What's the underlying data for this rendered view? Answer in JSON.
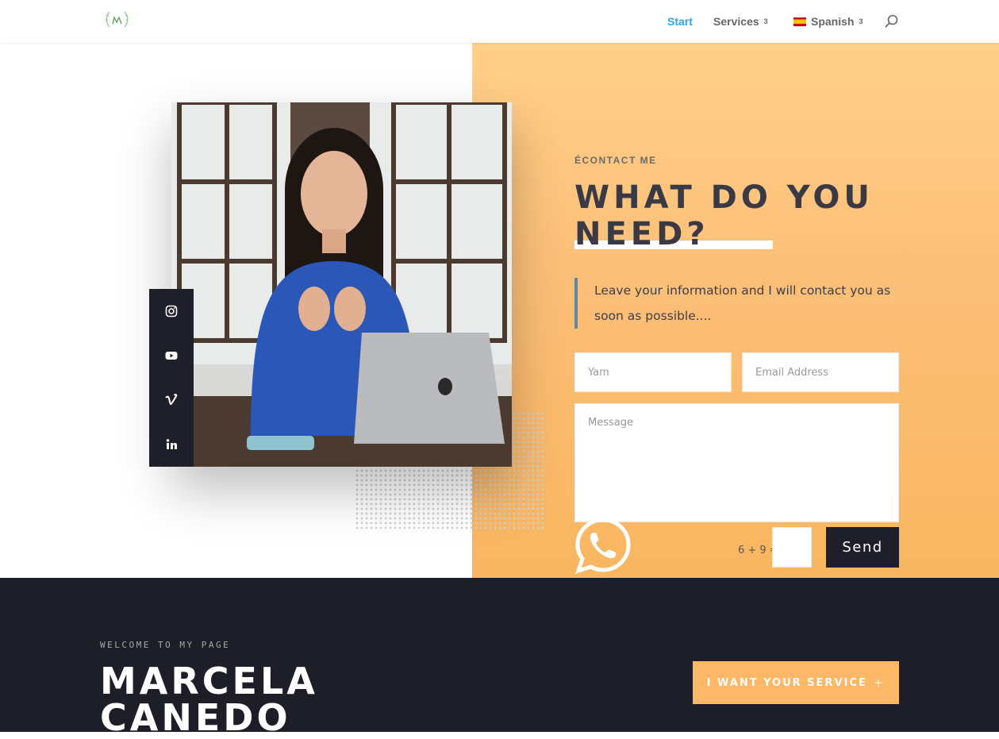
{
  "header": {
    "nav": [
      {
        "label": "Start",
        "active": true
      },
      {
        "label": "Services",
        "caret": "3"
      },
      {
        "label": "Spanish",
        "caret": "3",
        "flag": "es"
      }
    ],
    "search_icon": "search-icon",
    "colors": {
      "active": "#2ea3f2",
      "text": "#666666"
    }
  },
  "social": [
    "instagram-icon",
    "youtube-icon",
    "vimeo-icon",
    "linkedin-icon"
  ],
  "contact": {
    "eyebrow": "ÉCONTACT ME",
    "headline": "WHAT DO YOU NEED?",
    "intro": "Leave your information and I will contact you as soon as possible....",
    "form": {
      "name_placeholder": "Yam",
      "email_placeholder": "Email Address",
      "message_placeholder": "Message",
      "captcha": "6 + 9 =",
      "send_label": "Send"
    },
    "whatsapp_icon": "whatsapp-icon"
  },
  "footer": {
    "welcome": "WELCOME TO MY PAGE",
    "name": "MARCELA CANEDO",
    "service_button": "I WANT YOUR SERVICE",
    "service_button_icon": "+"
  },
  "colors": {
    "gradient_top": "#ffd089",
    "gradient_bottom": "#f9b660",
    "dark": "#1f1f2a",
    "button": "#fcb867"
  }
}
